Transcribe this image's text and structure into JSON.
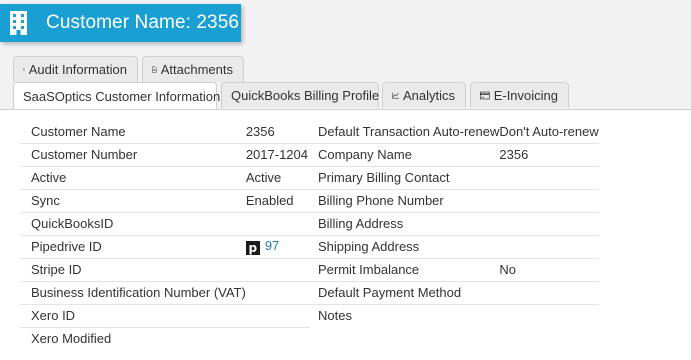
{
  "header": {
    "title": "Customer Name: 2356",
    "icon": "building-icon",
    "color": "#1a9fd3"
  },
  "tabs_top": [
    {
      "label": "Audit Information",
      "icon": "clipboard-icon"
    },
    {
      "label": "Attachments",
      "icon": "document-icon"
    }
  ],
  "tabs_bottom": [
    {
      "label": "SaaSOptics Customer Information",
      "active": true
    },
    {
      "label": "QuickBooks Billing Profile"
    },
    {
      "label": "Analytics",
      "icon": "chart-icon"
    },
    {
      "label": "E-Invoicing",
      "icon": "card-icon"
    }
  ],
  "left_fields": [
    {
      "label": "Customer Name",
      "value": "2356"
    },
    {
      "label": "Customer Number",
      "value": "2017-1204"
    },
    {
      "label": "Active",
      "value": "Active"
    },
    {
      "label": "Sync",
      "value": "Enabled"
    },
    {
      "label": "QuickBooksID",
      "value": ""
    },
    {
      "label": "Pipedrive ID",
      "value": "97",
      "logo": "p"
    },
    {
      "label": "Stripe ID",
      "value": ""
    },
    {
      "label": "Business Identification Number (VAT)",
      "value": ""
    },
    {
      "label": "Xero ID",
      "value": ""
    },
    {
      "label": "Xero Modified",
      "value": ""
    }
  ],
  "right_fields": [
    {
      "label": "Default Transaction Auto-renew",
      "value": "Don't Auto-renew"
    },
    {
      "label": "Company Name",
      "value": "2356"
    },
    {
      "label": "Primary Billing Contact",
      "value": ""
    },
    {
      "label": "Billing Phone Number",
      "value": ""
    },
    {
      "label": "Billing Address",
      "value": ""
    },
    {
      "label": "Shipping Address",
      "value": ""
    },
    {
      "label": "Permit Imbalance",
      "value": "No"
    },
    {
      "label": "Default Payment Method",
      "value": ""
    },
    {
      "label": "Notes",
      "value": ""
    }
  ]
}
